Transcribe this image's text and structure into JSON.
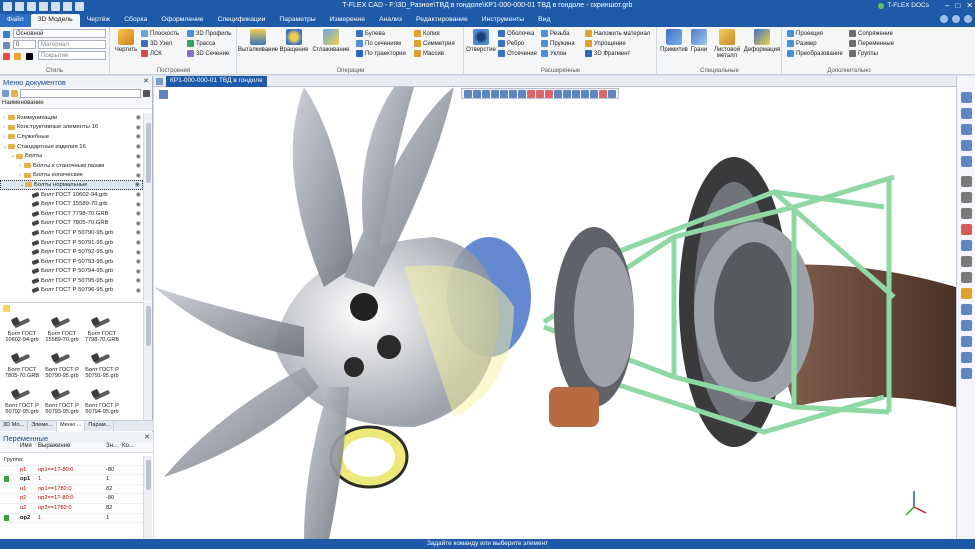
{
  "window": {
    "title": "T-FLEX CAD - F:\\3D_Разное\\ТВД в гондоле\\КР1-000-000-01 ТВД в гондоле - скриншот.grb",
    "account": "T-FLEX DOCs"
  },
  "tabs": [
    "Файл",
    "3D Модель",
    "Чертёж",
    "Сборка",
    "Оформление",
    "Спецификации",
    "Параметры",
    "Измерение",
    "Анализ",
    "Редактирование",
    "Инструменты",
    "Вид"
  ],
  "style_group": {
    "label": "Стиль",
    "combo_style": "Основной",
    "combo_layer": "0",
    "combo_material": "Материал",
    "combo_cover": "Покрытие"
  },
  "construct_group": {
    "label": "Построения",
    "draw": "Чертить",
    "plane": "Плоскость",
    "node": "3D Узел",
    "lsk": "ЛСК",
    "profile": "3D Профиль",
    "route": "Трасса",
    "section": "3D Сечение"
  },
  "ops_group": {
    "label": "Операции",
    "extrude": "Выталкивание",
    "revolve": "Вращение",
    "loft": "Сглаживание",
    "boolean": "Булева",
    "by_sections": "По сечениям",
    "by_path": "По траектории",
    "copy": "Копия",
    "symmetry": "Симметрия",
    "array": "Массив"
  },
  "ext_group": {
    "label": "Расширенные",
    "hole": "Отверстие",
    "shell": "Оболочка",
    "rib": "Ребро",
    "cut": "Отсечение",
    "thread": "Резьба",
    "spring": "Пружина",
    "slope": "Уклон",
    "apply_material": "Наложить материал",
    "simplify": "Упрощение",
    "fragment": "3D Фрагмент"
  },
  "special_group": {
    "label": "Специальные",
    "primitive": "Примитив",
    "faces": "Грани",
    "sheet": "Листовой металл",
    "deform": "Деформация"
  },
  "extra_group": {
    "label": "Дополнительно",
    "projection": "Проекция",
    "dimension": "Размер",
    "transform": "Преобразование",
    "mating": "Сопряжение",
    "variables": "Переменные",
    "groups": "Группы"
  },
  "doc_menu": {
    "title": "Меню документов",
    "column": "Наименование",
    "tree": [
      {
        "label": "Коммуникации",
        "kind": "folder",
        "level": 0,
        "tri": "›"
      },
      {
        "label": "Конструктивные элементы 16",
        "kind": "folder",
        "level": 0,
        "tri": "›"
      },
      {
        "label": "Служебные",
        "kind": "folder",
        "level": 0,
        "tri": "›"
      },
      {
        "label": "Стандартные изделия 16",
        "kind": "folder",
        "level": 0,
        "tri": "⌄"
      },
      {
        "label": "Болты",
        "kind": "folder",
        "level": 1,
        "tri": "⌄"
      },
      {
        "label": "Болты к станочным пазам",
        "kind": "folder",
        "level": 2,
        "tri": "›"
      },
      {
        "label": "Болты конические",
        "kind": "folder",
        "level": 2,
        "tri": "›"
      },
      {
        "label": "Болты нормальные",
        "kind": "folder",
        "level": 2,
        "tri": "⌄",
        "selected": true
      },
      {
        "label": "Болт ГОСТ 10602-94.grb",
        "kind": "bolt",
        "level": 3,
        "tri": ""
      },
      {
        "label": "Болт ГОСТ 15589-70.grb",
        "kind": "bolt",
        "level": 3,
        "tri": ""
      },
      {
        "label": "Болт ГОСТ 7798-70.GRB",
        "kind": "bolt",
        "level": 3,
        "tri": ""
      },
      {
        "label": "Болт ГОСТ 7805-70.GRB",
        "kind": "bolt",
        "level": 3,
        "tri": ""
      },
      {
        "label": "Болт ГОСТ Р 50790-95.grb",
        "kind": "bolt",
        "level": 3,
        "tri": ""
      },
      {
        "label": "Болт ГОСТ Р 50791-95.grb",
        "kind": "bolt",
        "level": 3,
        "tri": ""
      },
      {
        "label": "Болт ГОСТ Р 50792-95.grb",
        "kind": "bolt",
        "level": 3,
        "tri": ""
      },
      {
        "label": "Болт ГОСТ Р 50793-95.grb",
        "kind": "bolt",
        "level": 3,
        "tri": ""
      },
      {
        "label": "Болт ГОСТ Р 50794-95.grb",
        "kind": "bolt",
        "level": 3,
        "tri": ""
      },
      {
        "label": "Болт ГОСТ Р 50795-95.grb",
        "kind": "bolt",
        "level": 3,
        "tri": ""
      },
      {
        "label": "Болт ГОСТ Р 50796-95.grb",
        "kind": "bolt",
        "level": 3,
        "tri": ""
      }
    ],
    "gallery": [
      {
        "l1": "Болт ГОСТ",
        "l2": "10602-94.grb"
      },
      {
        "l1": "Болт ГОСТ",
        "l2": "15589-70.grb"
      },
      {
        "l1": "Болт ГОСТ",
        "l2": "7798-70.GRB"
      },
      {
        "l1": "Болт ГОСТ",
        "l2": "7805-70.GRB"
      },
      {
        "l1": "Болт ГОСТ Р",
        "l2": "50790-95.grb"
      },
      {
        "l1": "Болт ГОСТ Р",
        "l2": "50791-95.grb"
      },
      {
        "l1": "Болт ГОСТ Р",
        "l2": "50792-95.grb"
      },
      {
        "l1": "Болт ГОСТ Р",
        "l2": "50793-95.grb"
      },
      {
        "l1": "Болт ГОСТ Р",
        "l2": "50794-95.grb"
      }
    ]
  },
  "bottom_tabs": [
    "3D Мо...",
    "Элеме...",
    "Меню ...",
    "Парам..."
  ],
  "variables": {
    "title": "Переменные",
    "cols": {
      "name": "Имя",
      "expr": "Выражение",
      "val": "Зн...",
      "ko": "Ко..."
    },
    "group": "Группа:",
    "rows": [
      {
        "name": "p1",
        "expr": "op1==1?-80:0",
        "val": "-80",
        "flag": false,
        "bold": false
      },
      {
        "name": "op1",
        "expr": "1",
        "val": "1",
        "flag": true,
        "bold": true
      },
      {
        "name": "u1",
        "expr": "op1==1?82:0",
        "val": "82",
        "flag": false,
        "bold": false
      },
      {
        "name": "p2",
        "expr": "op2==1?-80:0",
        "val": "-80",
        "flag": false,
        "bold": false
      },
      {
        "name": "u2",
        "expr": "op2==1?82:0",
        "val": "82",
        "flag": false,
        "bold": false
      },
      {
        "name": "op2",
        "expr": "1",
        "val": "1",
        "flag": true,
        "bold": true
      }
    ]
  },
  "document_tab": "КР1-000-000-01 ТВД в гондоле",
  "status_text": "Задайте команду или выберите элемент",
  "colors": {
    "brand": "#1e5aa8",
    "accent_green": "#86d09a",
    "nacelle": "#6b4a3a"
  }
}
